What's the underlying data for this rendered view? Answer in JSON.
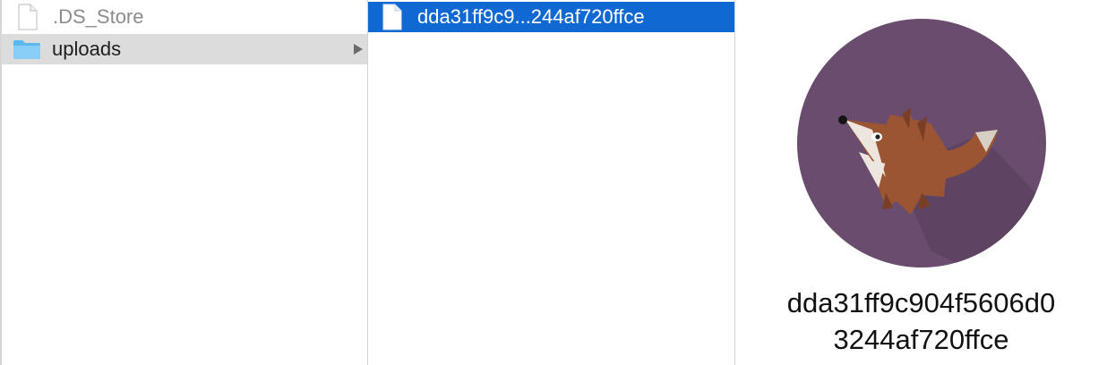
{
  "sidebar_column": {
    "items": [
      {
        "name": ".DS_Store",
        "icon": "document-icon",
        "state": "dimmed"
      },
      {
        "name": "uploads",
        "icon": "folder-icon",
        "state": "selected-inactive",
        "has_children": true
      }
    ]
  },
  "uploads_column": {
    "items": [
      {
        "name": "dda31ff9c9...244af720ffce",
        "icon": "document-icon",
        "state": "selected-active"
      }
    ]
  },
  "preview": {
    "image": "fox-avatar-image",
    "name_line1": "dda31ff9c904f5606d0",
    "name_line2": "3244af720ffce"
  },
  "colors": {
    "selection_active": "#1069d3",
    "selection_inactive": "#dcdcdc",
    "avatar_background": "#6a4d6e",
    "fox_body": "#9b5533"
  }
}
